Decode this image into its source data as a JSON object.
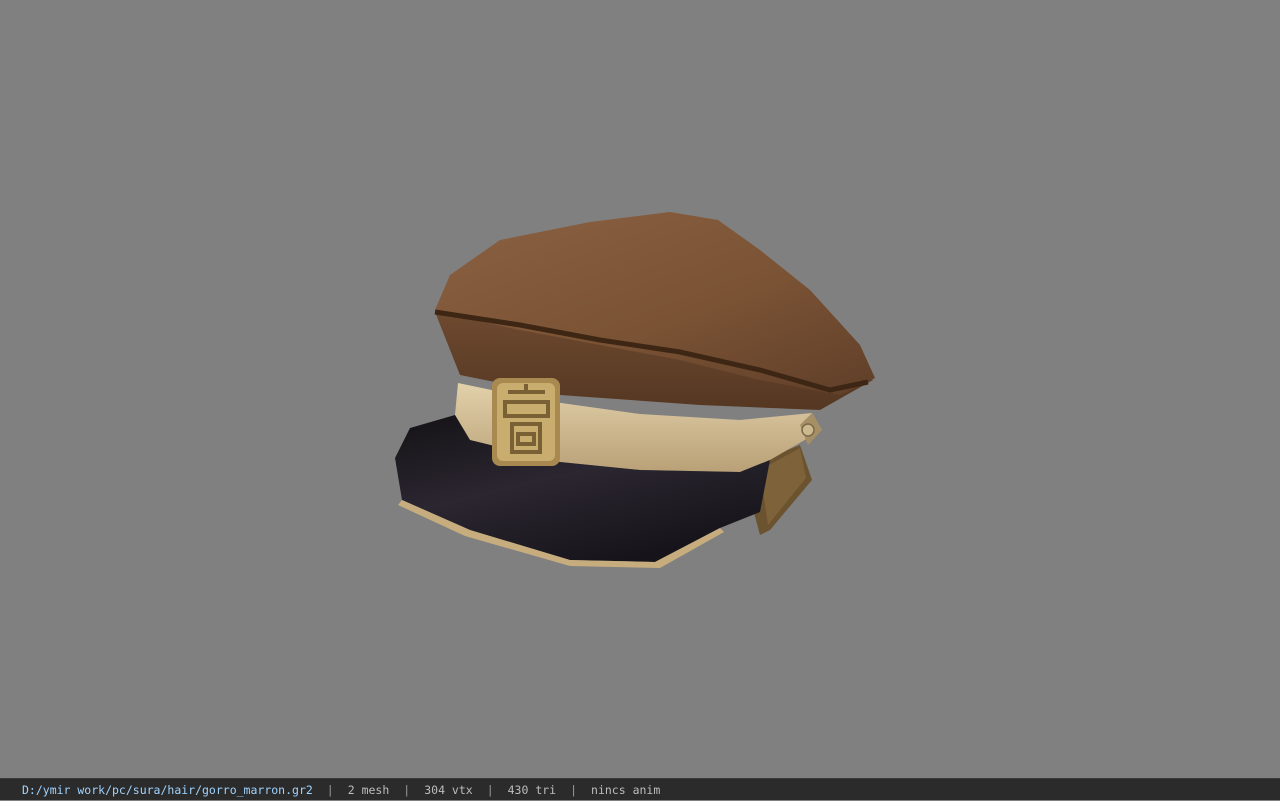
{
  "viewer": {
    "background_color": "#808080",
    "model_name": "gorro_marron",
    "model_icon": "cap-icon"
  },
  "status": {
    "file_path": "D:/ymir work/pc/sura/hair/gorro_marron.gr2",
    "mesh": "2 mesh",
    "vtx": "304 vtx",
    "tri": "430 tri",
    "anim": "nincs anim",
    "separator": "|"
  },
  "colors": {
    "crown": "#7a5234",
    "crown_shadow": "#5a3a24",
    "band": "#d8c49a",
    "visor": "#1e1a20",
    "visor_edge": "#c9b38a",
    "badge": "#b79a5e"
  }
}
